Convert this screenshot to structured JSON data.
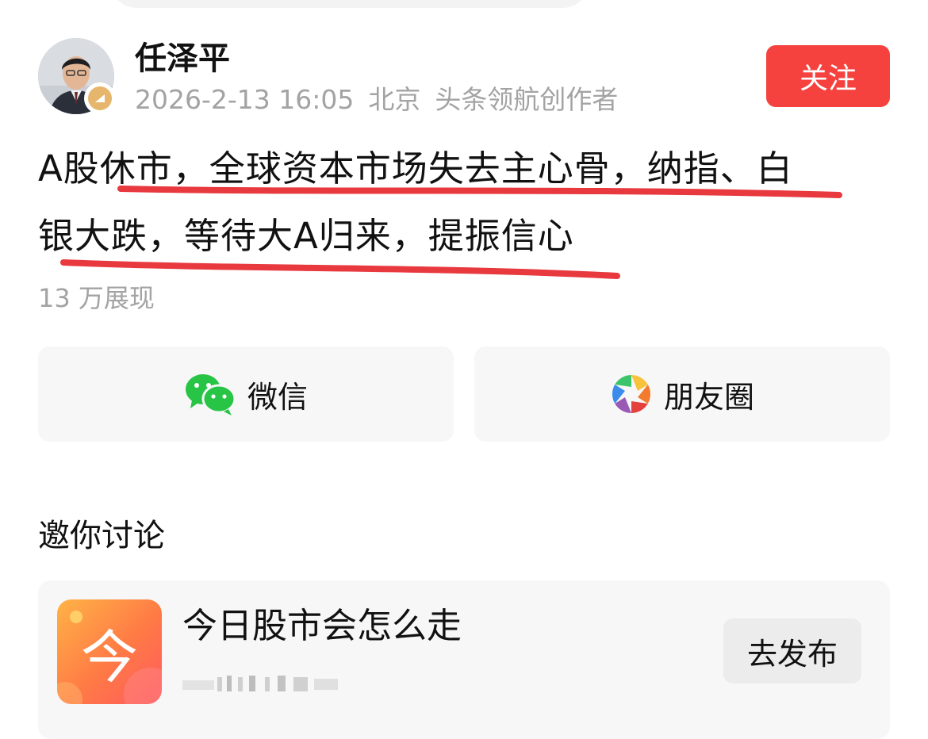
{
  "author": {
    "name": "任泽平",
    "date": "2026-2-13 16:05",
    "location": "北京",
    "title": "头条领航创作者",
    "follow_label": "关注"
  },
  "post": {
    "headline_line1": "A股休市，全球资本市场失去主心骨，纳指、白",
    "headline_line2": "银大跌，等待大A归来，提振信心",
    "impressions": "13 万展现"
  },
  "share": {
    "wechat_label": "微信",
    "moments_label": "朋友圈"
  },
  "discussion": {
    "section_title": "邀你讨论",
    "topic_icon_char": "今",
    "topic_title": "今日股市会怎么走",
    "publish_label": "去发布"
  },
  "colors": {
    "accent_red": "#f5423f",
    "underline_red": "#e8393f",
    "wechat_green": "#28c445",
    "meta_gray": "#a3a3a3"
  },
  "icons": [
    "avatar-photo",
    "creator-badge-icon",
    "wechat-icon",
    "moments-icon",
    "topic-icon"
  ]
}
